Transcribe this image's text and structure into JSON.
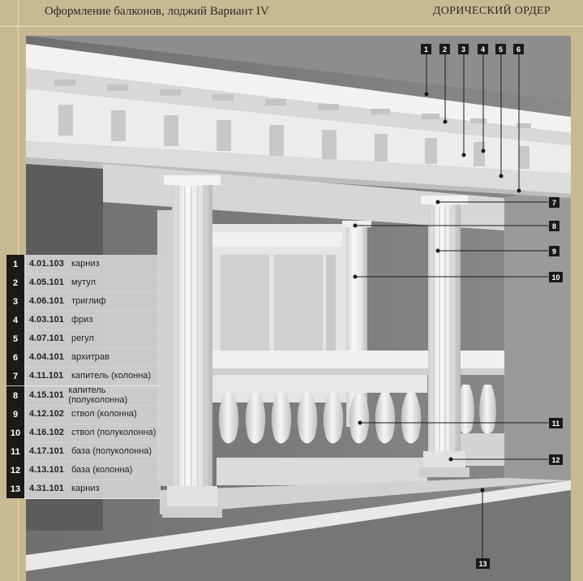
{
  "header": {
    "left_title": "Оформление балконов, лоджий Вариант IV",
    "right_title": "ДОРИЧЕСКИЙ ОРДЕР"
  },
  "legend": [
    {
      "num": "1",
      "code": "4.01.103",
      "name": "карниз"
    },
    {
      "num": "2",
      "code": "4.05.101",
      "name": "мутул"
    },
    {
      "num": "3",
      "code": "4.06.101",
      "name": "триглиф"
    },
    {
      "num": "4",
      "code": "4.03.101",
      "name": "фриз"
    },
    {
      "num": "5",
      "code": "4.07.101",
      "name": "регул"
    },
    {
      "num": "6",
      "code": "4.04.101",
      "name": "архитрав"
    },
    {
      "num": "7",
      "code": "4.11.101",
      "name": "капитель (колонна)"
    },
    {
      "num": "8",
      "code": "4.15.101",
      "name": "капитель (полуколонна)"
    },
    {
      "num": "9",
      "code": "4.12.102",
      "name": "ствол (колонна)"
    },
    {
      "num": "10",
      "code": "4.16.102",
      "name": "ствол (полуколонна)"
    },
    {
      "num": "11",
      "code": "4.17.101",
      "name": "база (полуколонна)"
    },
    {
      "num": "12",
      "code": "4.13.101",
      "name": "база (колонна)"
    },
    {
      "num": "13",
      "code": "4.31.101",
      "name": "карниз"
    }
  ],
  "callouts": {
    "c1": "1",
    "c2": "2",
    "c3": "3",
    "c4": "4",
    "c5": "5",
    "c6": "6",
    "c7": "7",
    "c8": "8",
    "c9": "9",
    "c10": "10",
    "c11": "11",
    "c12": "12",
    "c13": "13"
  }
}
